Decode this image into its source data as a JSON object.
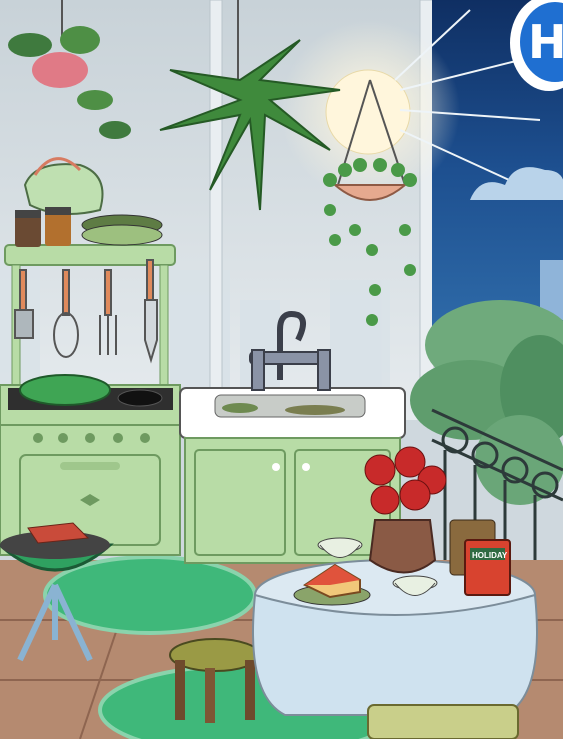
{
  "hud": {
    "home_button_label": "H",
    "home_button_icon": "home-icon"
  },
  "items": {
    "book_title": "HOLIDAY"
  },
  "colors": {
    "sky_night": "#163e78",
    "sky_day": "#d5dde2",
    "mint_green": "#b8dca6",
    "mint_dark": "#6e9a60",
    "rug_green": "#3fb87a",
    "floor": "#b58a70",
    "tablecloth": "#cfe2ef",
    "hud_blue": "#1f6fd1"
  }
}
